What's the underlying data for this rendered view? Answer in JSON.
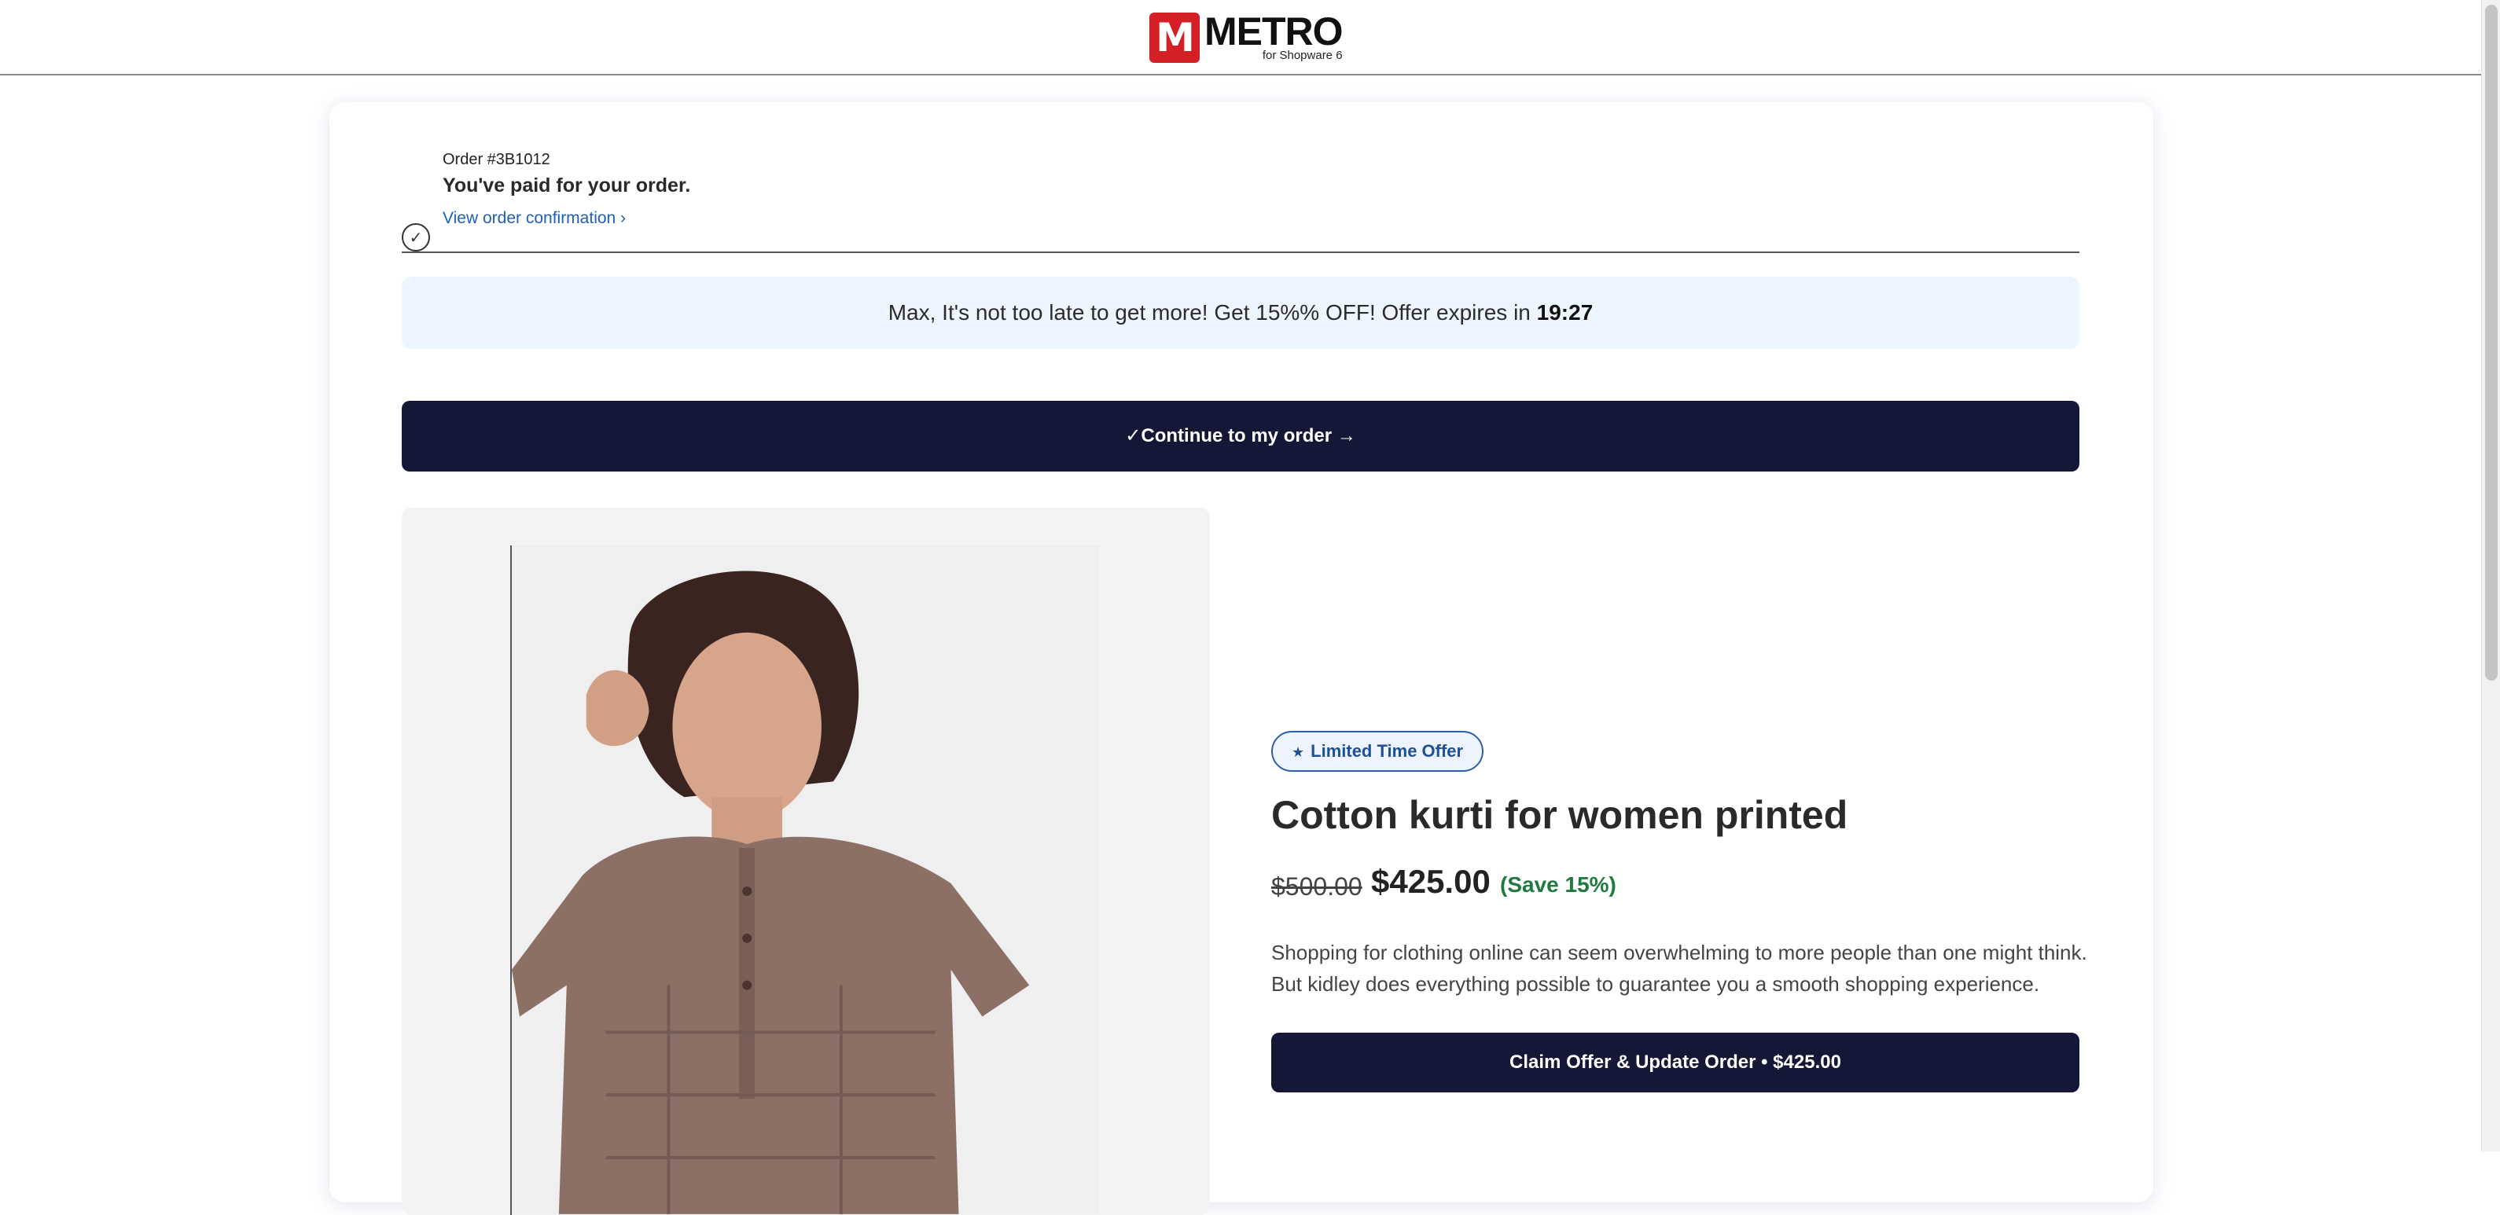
{
  "brand": {
    "logo_letter": "M",
    "name": "METRO",
    "subtitle": "for Shopware 6",
    "color": "#d51f26"
  },
  "order": {
    "number": "Order #3B1012",
    "paid_text": "You've paid for your order.",
    "view_confirmation": "View order confirmation ›",
    "check_icon": "✓"
  },
  "offer": {
    "message": "Max, It's not too late to get more! Get 15%% OFF! Offer expires in",
    "timer": "19:27"
  },
  "continue_button": "✓Continue to my order →",
  "product": {
    "badge": "Limited Time Offer",
    "badge_icon": "★",
    "title": "Cotton kurti for women printed",
    "old_price": "$500.00",
    "new_price": "$425.00",
    "savings": "(Save 15%)",
    "description": "Shopping for clothing online can seem overwhelming to more people than one might think. But kidley does everything possible to guarantee you a smooth shopping experience.",
    "claim_button": "Claim Offer & Update Order • $425.00"
  },
  "colors": {
    "button_bg": "#141836",
    "banner_bg": "#edf5ff",
    "link": "#1f5fb8",
    "savings": "#1e7a3e"
  }
}
